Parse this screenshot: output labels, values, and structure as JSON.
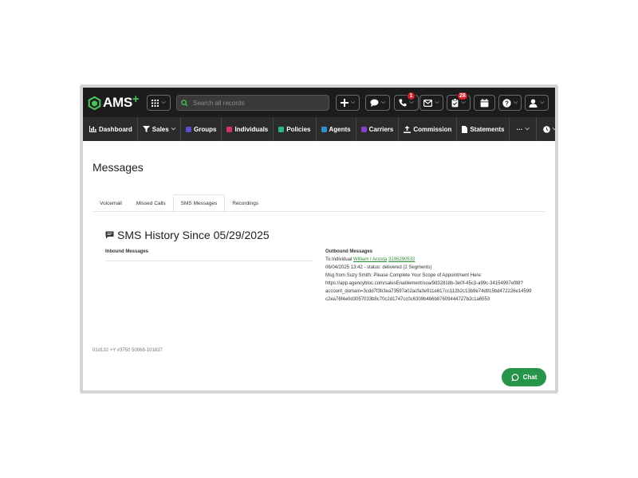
{
  "app": {
    "logo_text": "AMS",
    "logo_plus": "+"
  },
  "search": {
    "placeholder": "Search all records"
  },
  "toolbar": {
    "phone_badge": "1",
    "tasks_badge": "28"
  },
  "nav": {
    "items": [
      {
        "label": "Dashboard",
        "icon": "bar-chart-icon"
      },
      {
        "label": "Sales",
        "icon": "funnel-icon"
      },
      {
        "label": "Groups",
        "icon": "square-icon",
        "color": "#5b4fc7"
      },
      {
        "label": "Individuals",
        "icon": "square-icon",
        "color": "#d4336b"
      },
      {
        "label": "Policies",
        "icon": "square-icon",
        "color": "#2fb38a"
      },
      {
        "label": "Agents",
        "icon": "square-icon",
        "color": "#2f8fd1"
      },
      {
        "label": "Carriers",
        "icon": "square-icon",
        "color": "#8a3fc9"
      },
      {
        "label": "Commission",
        "icon": "upload-icon"
      },
      {
        "label": "Statements",
        "icon": "document-icon"
      },
      {
        "label": "···",
        "icon": "more-icon"
      }
    ]
  },
  "page": {
    "title": "Messages"
  },
  "tabs": [
    {
      "label": "Voicemail",
      "active": false
    },
    {
      "label": "Missed Calls",
      "active": false
    },
    {
      "label": "SMS Messages",
      "active": true
    },
    {
      "label": "Recordings",
      "active": false
    }
  ],
  "sms": {
    "title": "SMS History Since 05/29/2025",
    "inbound_label": "Inbound Messages",
    "outbound_label": "Outbound Messages",
    "to_prefix": "To Individual",
    "to_name": "William I Acosta",
    "to_phone": "3195290532",
    "status_line": "06/04/2025 13:42 - status: delivered (2 Segments)",
    "msg_line1": "Msg from Suzy Smith: Please Complete Your Scope of Appointment Here:",
    "msg_line2": "https://app.agencybloc.com/salesEnablement/soa/9d32818b-3e0f-45c3-a99c-34154997ef88?",
    "msg_line3": "account_domain=3cdd7f3b3ea73597a02acfa3e911e617cc112b2c13b9e74d915bd472226e14599",
    "msg_line4": "c2ea76f4e0d3057033b8c70c2d1747cc0c6309b466b87609444727b2c1a6553"
  },
  "footer": {
    "id_text": "01d132 +Y #3750 50068-101637"
  },
  "chat": {
    "label": "Chat"
  },
  "colors": {
    "topbar": "#1c1c1c",
    "navbar": "#2b2b2b",
    "accent_green": "#27944a",
    "badge_red": "#d61f26"
  }
}
